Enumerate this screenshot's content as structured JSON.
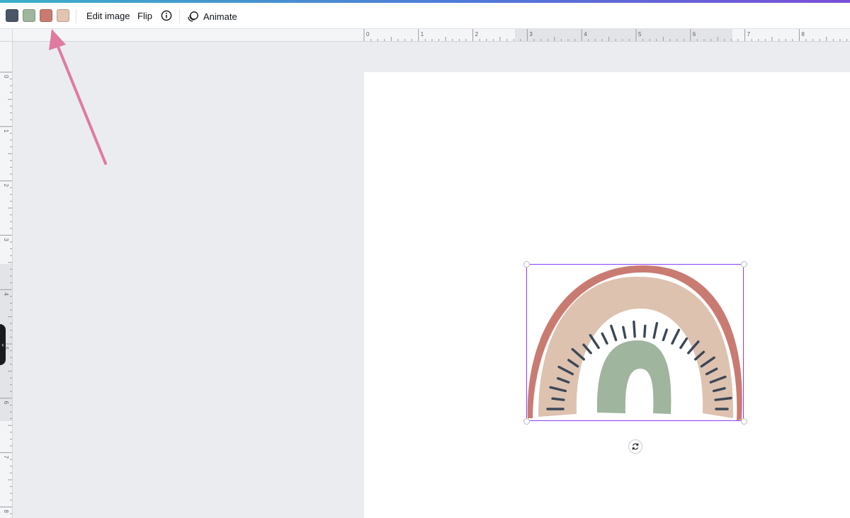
{
  "toolbar": {
    "swatches": [
      {
        "name": "navy",
        "color": "#4a5568"
      },
      {
        "name": "sage",
        "color": "#9fb59d"
      },
      {
        "name": "terracotta",
        "color": "#c97b72"
      },
      {
        "name": "blush",
        "color": "#e2c4b2"
      }
    ],
    "edit_image_label": "Edit image",
    "flip_label": "Flip",
    "info_icon": "info-icon",
    "animate_label": "Animate",
    "animate_icon": "animate-icon"
  },
  "rulers": {
    "top_labels": [
      "0",
      "1",
      "2",
      "3",
      "4",
      "5",
      "6",
      "7",
      "8"
    ],
    "left_labels": [
      "0",
      "1",
      "2",
      "3",
      "4",
      "5",
      "6",
      "7",
      "8"
    ]
  },
  "canvas": {
    "element": "boho-rainbow-graphic",
    "colors": {
      "outer_arc": "#c97b72",
      "middle_arc": "#ddc2b0",
      "rays": "#3c4756",
      "inner_arc": "#9fb59d",
      "selection": "#8b3dff"
    },
    "rotate_icon": "rotate-icon"
  },
  "annotation": {
    "arrow_color": "#e07aa0"
  },
  "side_panel": {
    "collapse_icon": "chevron-left-icon"
  }
}
